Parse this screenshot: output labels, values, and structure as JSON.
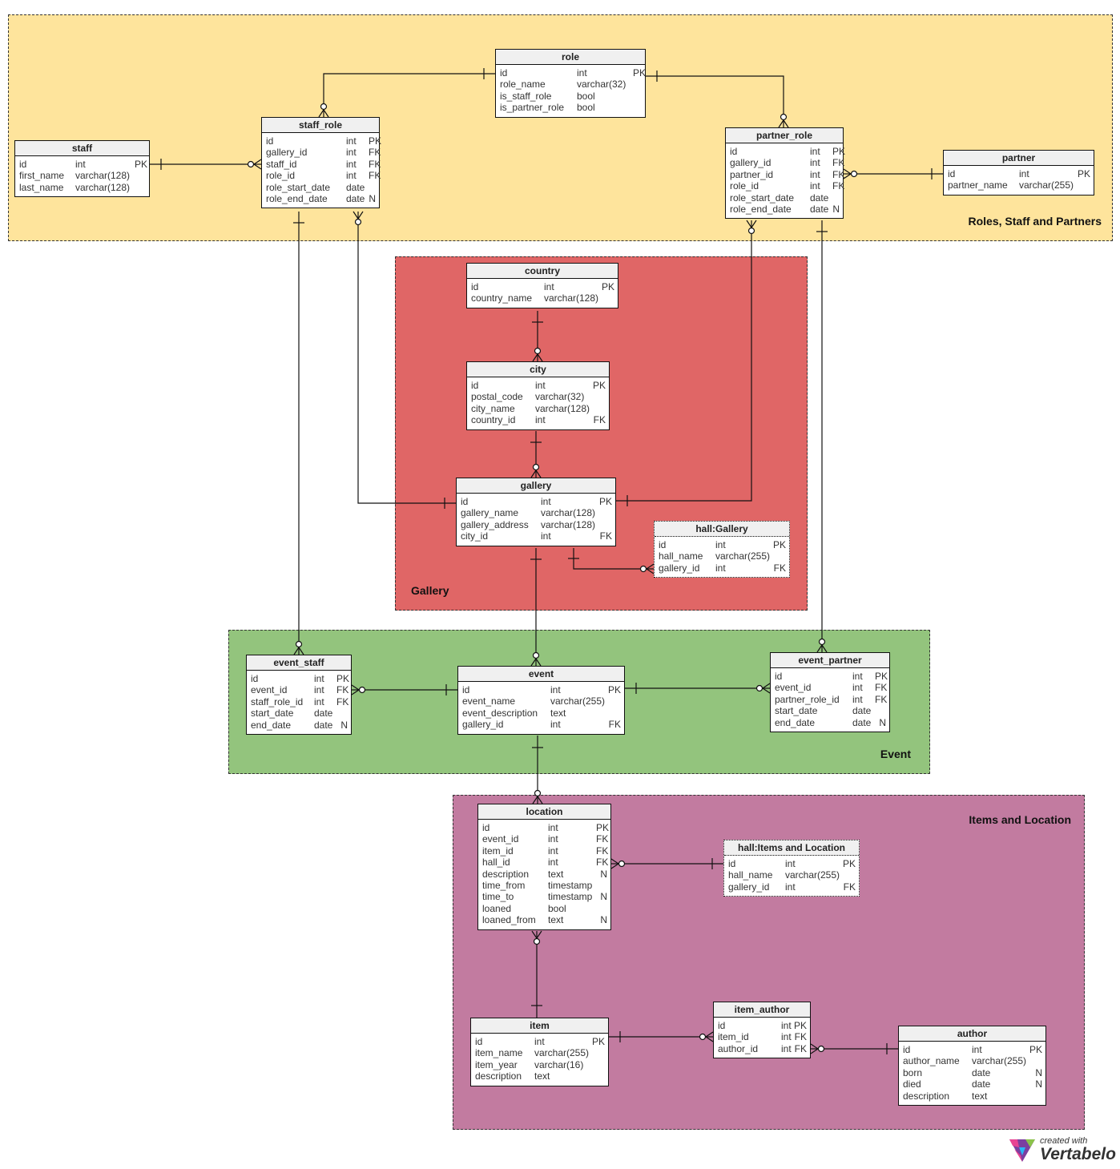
{
  "areas": {
    "roles": {
      "label": "Roles, Staff and Partners",
      "color": "#fee49c"
    },
    "gallery": {
      "label": "Gallery",
      "color": "#e06666"
    },
    "event": {
      "label": "Event",
      "color": "#93c47d"
    },
    "items": {
      "label": "Items and Location",
      "color": "#c27ba0"
    }
  },
  "tables": {
    "staff": {
      "title": "staff",
      "columns": [
        {
          "name": "id",
          "type": "int",
          "key": "PK"
        },
        {
          "name": "first_name",
          "type": "varchar(128)",
          "key": ""
        },
        {
          "name": "last_name",
          "type": "varchar(128)",
          "key": ""
        }
      ]
    },
    "staff_role": {
      "title": "staff_role",
      "columns": [
        {
          "name": "id",
          "type": "int",
          "key": "PK"
        },
        {
          "name": "gallery_id",
          "type": "int",
          "key": "FK"
        },
        {
          "name": "staff_id",
          "type": "int",
          "key": "FK"
        },
        {
          "name": "role_id",
          "type": "int",
          "key": "FK"
        },
        {
          "name": "role_start_date",
          "type": "date",
          "key": ""
        },
        {
          "name": "role_end_date",
          "type": "date",
          "key": "N"
        }
      ]
    },
    "role": {
      "title": "role",
      "columns": [
        {
          "name": "id",
          "type": "int",
          "key": "PK"
        },
        {
          "name": "role_name",
          "type": "varchar(32)",
          "key": ""
        },
        {
          "name": "is_staff_role",
          "type": "bool",
          "key": ""
        },
        {
          "name": "is_partner_role",
          "type": "bool",
          "key": ""
        }
      ]
    },
    "partner_role": {
      "title": "partner_role",
      "columns": [
        {
          "name": "id",
          "type": "int",
          "key": "PK"
        },
        {
          "name": "gallery_id",
          "type": "int",
          "key": "FK"
        },
        {
          "name": "partner_id",
          "type": "int",
          "key": "FK"
        },
        {
          "name": "role_id",
          "type": "int",
          "key": "FK"
        },
        {
          "name": "role_start_date",
          "type": "date",
          "key": ""
        },
        {
          "name": "role_end_date",
          "type": "date",
          "key": "N"
        }
      ]
    },
    "partner": {
      "title": "partner",
      "columns": [
        {
          "name": "id",
          "type": "int",
          "key": "PK"
        },
        {
          "name": "partner_name",
          "type": "varchar(255)",
          "key": ""
        }
      ]
    },
    "country": {
      "title": "country",
      "columns": [
        {
          "name": "id",
          "type": "int",
          "key": "PK"
        },
        {
          "name": "country_name",
          "type": "varchar(128)",
          "key": ""
        }
      ]
    },
    "city": {
      "title": "city",
      "columns": [
        {
          "name": "id",
          "type": "int",
          "key": "PK"
        },
        {
          "name": "postal_code",
          "type": "varchar(32)",
          "key": ""
        },
        {
          "name": "city_name",
          "type": "varchar(128)",
          "key": ""
        },
        {
          "name": "country_id",
          "type": "int",
          "key": "FK"
        }
      ]
    },
    "gallery": {
      "title": "gallery",
      "columns": [
        {
          "name": "id",
          "type": "int",
          "key": "PK"
        },
        {
          "name": "gallery_name",
          "type": "varchar(128)",
          "key": ""
        },
        {
          "name": "gallery_address",
          "type": "varchar(128)",
          "key": ""
        },
        {
          "name": "city_id",
          "type": "int",
          "key": "FK"
        }
      ]
    },
    "hall_gallery": {
      "title": "hall:Gallery",
      "columns": [
        {
          "name": "id",
          "type": "int",
          "key": "PK"
        },
        {
          "name": "hall_name",
          "type": "varchar(255)",
          "key": ""
        },
        {
          "name": "gallery_id",
          "type": "int",
          "key": "FK"
        }
      ]
    },
    "event_staff": {
      "title": "event_staff",
      "columns": [
        {
          "name": "id",
          "type": "int",
          "key": "PK"
        },
        {
          "name": "event_id",
          "type": "int",
          "key": "FK"
        },
        {
          "name": "staff_role_id",
          "type": "int",
          "key": "FK"
        },
        {
          "name": "start_date",
          "type": "date",
          "key": ""
        },
        {
          "name": "end_date",
          "type": "date",
          "key": "N"
        }
      ]
    },
    "event": {
      "title": "event",
      "columns": [
        {
          "name": "id",
          "type": "int",
          "key": "PK"
        },
        {
          "name": "event_name",
          "type": "varchar(255)",
          "key": ""
        },
        {
          "name": "event_description",
          "type": "text",
          "key": ""
        },
        {
          "name": "gallery_id",
          "type": "int",
          "key": "FK"
        }
      ]
    },
    "event_partner": {
      "title": "event_partner",
      "columns": [
        {
          "name": "id",
          "type": "int",
          "key": "PK"
        },
        {
          "name": "event_id",
          "type": "int",
          "key": "FK"
        },
        {
          "name": "partner_role_id",
          "type": "int",
          "key": "FK"
        },
        {
          "name": "start_date",
          "type": "date",
          "key": ""
        },
        {
          "name": "end_date",
          "type": "date",
          "key": "N"
        }
      ]
    },
    "location": {
      "title": "location",
      "columns": [
        {
          "name": "id",
          "type": "int",
          "key": "PK"
        },
        {
          "name": "event_id",
          "type": "int",
          "key": "FK"
        },
        {
          "name": "item_id",
          "type": "int",
          "key": "FK"
        },
        {
          "name": "hall_id",
          "type": "int",
          "key": "FK"
        },
        {
          "name": "description",
          "type": "text",
          "key": "N"
        },
        {
          "name": "time_from",
          "type": "timestamp",
          "key": ""
        },
        {
          "name": "time_to",
          "type": "timestamp",
          "key": "N"
        },
        {
          "name": "loaned",
          "type": "bool",
          "key": ""
        },
        {
          "name": "loaned_from",
          "type": "text",
          "key": "N"
        }
      ]
    },
    "hall_items": {
      "title": "hall:Items and Location",
      "columns": [
        {
          "name": "id",
          "type": "int",
          "key": "PK"
        },
        {
          "name": "hall_name",
          "type": "varchar(255)",
          "key": ""
        },
        {
          "name": "gallery_id",
          "type": "int",
          "key": "FK"
        }
      ]
    },
    "item": {
      "title": "item",
      "columns": [
        {
          "name": "id",
          "type": "int",
          "key": "PK"
        },
        {
          "name": "item_name",
          "type": "varchar(255)",
          "key": ""
        },
        {
          "name": "item_year",
          "type": "varchar(16)",
          "key": ""
        },
        {
          "name": "description",
          "type": "text",
          "key": ""
        }
      ]
    },
    "item_author": {
      "title": "item_author",
      "columns": [
        {
          "name": "id",
          "type": "int",
          "key": "PK"
        },
        {
          "name": "item_id",
          "type": "int",
          "key": "FK"
        },
        {
          "name": "author_id",
          "type": "int",
          "key": "FK"
        }
      ]
    },
    "author": {
      "title": "author",
      "columns": [
        {
          "name": "id",
          "type": "int",
          "key": "PK"
        },
        {
          "name": "author_name",
          "type": "varchar(255)",
          "key": ""
        },
        {
          "name": "born",
          "type": "date",
          "key": "N"
        },
        {
          "name": "died",
          "type": "date",
          "key": "N"
        },
        {
          "name": "description",
          "type": "text",
          "key": ""
        }
      ]
    }
  },
  "relationships": [
    {
      "from": "role",
      "to": "staff_role",
      "label": "role-staff_role"
    },
    {
      "from": "role",
      "to": "partner_role",
      "label": "role-partner_role"
    },
    {
      "from": "staff",
      "to": "staff_role",
      "label": "staff-staff_role"
    },
    {
      "from": "partner",
      "to": "partner_role",
      "label": "partner-partner_role"
    },
    {
      "from": "country",
      "to": "city",
      "label": "country-city"
    },
    {
      "from": "city",
      "to": "gallery",
      "label": "city-gallery"
    },
    {
      "from": "gallery",
      "to": "staff_role",
      "label": "gallery-staff_role"
    },
    {
      "from": "gallery",
      "to": "partner_role",
      "label": "gallery-partner_role"
    },
    {
      "from": "gallery",
      "to": "hall_gallery",
      "label": "gallery-hall"
    },
    {
      "from": "gallery",
      "to": "event",
      "label": "gallery-event"
    },
    {
      "from": "staff_role",
      "to": "event_staff",
      "label": "staff_role-event_staff"
    },
    {
      "from": "partner_role",
      "to": "event_partner",
      "label": "partner_role-event_partner"
    },
    {
      "from": "event",
      "to": "event_staff",
      "label": "event-event_staff"
    },
    {
      "from": "event",
      "to": "event_partner",
      "label": "event-event_partner"
    },
    {
      "from": "event",
      "to": "location",
      "label": "event-location"
    },
    {
      "from": "hall_items",
      "to": "location",
      "label": "hall-location"
    },
    {
      "from": "item",
      "to": "location",
      "label": "item-location"
    },
    {
      "from": "item",
      "to": "item_author",
      "label": "item-item_author"
    },
    {
      "from": "author",
      "to": "item_author",
      "label": "author-item_author"
    }
  ],
  "logo": {
    "small": "created with",
    "big": "Vertabelo"
  }
}
